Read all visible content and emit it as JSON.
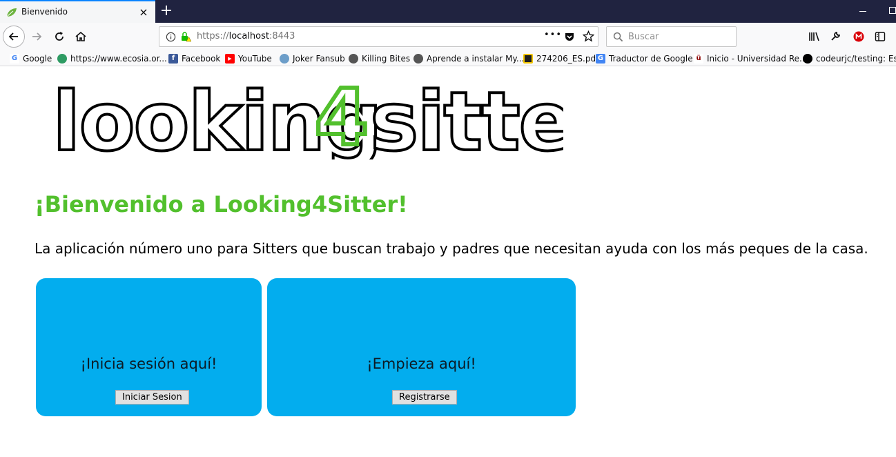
{
  "browser": {
    "tab_title": "Bienvenido",
    "tab_close": "×",
    "new_tab": "+",
    "url_scheme": "https://",
    "url_host": "localhost",
    "url_port": ":8443",
    "page_actions": "•••",
    "search_placeholder": "Buscar"
  },
  "bookmarks": [
    {
      "label": "Google",
      "icon": "google-icon",
      "color": "#4285f4",
      "glyph": "G"
    },
    {
      "label": "https://www.ecosia.or...",
      "icon": "ecosia-icon",
      "color": "#2e9b63",
      "glyph": ""
    },
    {
      "label": "Facebook",
      "icon": "facebook-icon",
      "color": "#3b5998",
      "glyph": "f"
    },
    {
      "label": "YouTube",
      "icon": "youtube-icon",
      "color": "#ff0000",
      "glyph": "▶"
    },
    {
      "label": "Joker Fansub",
      "icon": "globe-icon",
      "color": "#6d9ec9",
      "glyph": ""
    },
    {
      "label": "Killing Bites",
      "icon": "globe-icon",
      "color": "#555555",
      "glyph": ""
    },
    {
      "label": "Aprende a instalar My...",
      "icon": "globe-icon",
      "color": "#555555",
      "glyph": ""
    },
    {
      "label": "274206_ES.pdf",
      "icon": "pdf-icon",
      "color": "#1e1e1e",
      "glyph": ""
    },
    {
      "label": "Traductor de Google",
      "icon": "translate-icon",
      "color": "#4285f4",
      "glyph": "G"
    },
    {
      "label": "Inicio - Universidad Re...",
      "icon": "university-icon",
      "color": "#8b0000",
      "glyph": "ü"
    },
    {
      "label": "codeurjc/testing: Este",
      "icon": "github-icon",
      "color": "#000000",
      "glyph": ""
    }
  ],
  "page": {
    "logo_text_left": "looking",
    "logo_text_number": "4",
    "logo_text_right": "sitter",
    "welcome_title": "¡Bienvenido a Looking4Sitter!",
    "tagline": "La aplicación número uno para Sitters que buscan trabajo y padres que necesitan ayuda con los más peques de la casa.",
    "login_card": {
      "heading": "¡Inicia sesión aquí!",
      "button": "Iniciar Sesion"
    },
    "register_card": {
      "heading": "¡Empieza aquí!",
      "button": "Registrarse"
    }
  },
  "colors": {
    "accent_green": "#52c02d",
    "card_blue": "#03adee",
    "titlebar": "#202340"
  }
}
